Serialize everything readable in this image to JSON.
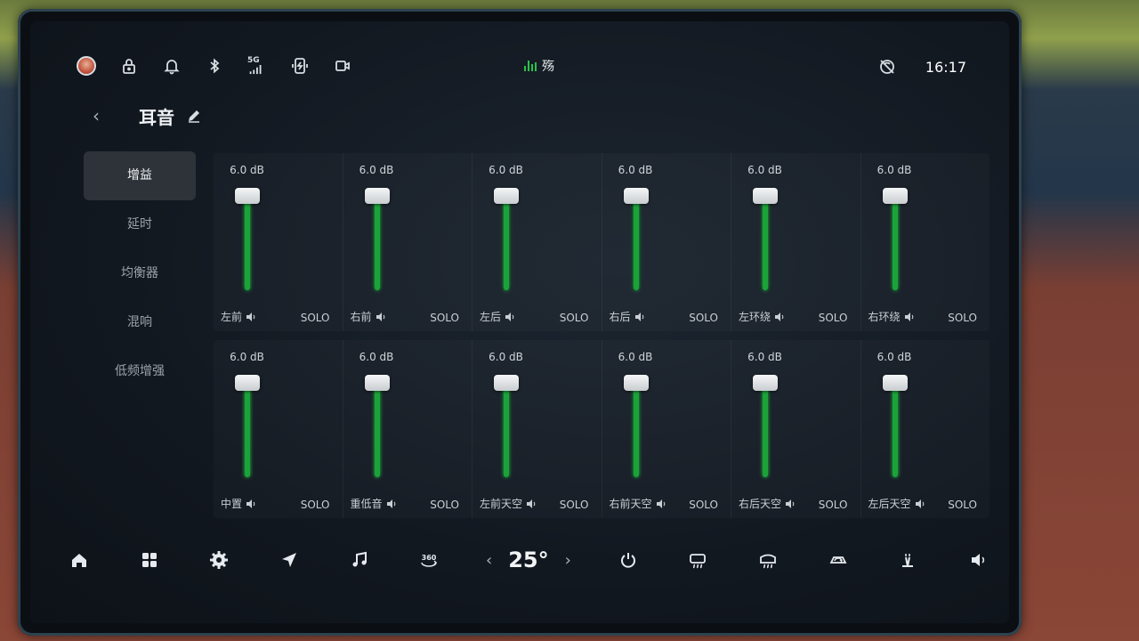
{
  "status_bar": {
    "network_label": "5G",
    "media_text": "殇",
    "time": "16:17",
    "icons": [
      "avatar",
      "lock-icon",
      "bell-icon",
      "bluetooth-icon",
      "signal-5g-icon",
      "phone-charge-icon",
      "camera-icon",
      "voice-off-icon"
    ]
  },
  "header": {
    "title": "耳音"
  },
  "sidebar": {
    "items": [
      {
        "label": "增益",
        "active": true
      },
      {
        "label": "延时",
        "active": false
      },
      {
        "label": "均衡器",
        "active": false
      },
      {
        "label": "混响",
        "active": false
      },
      {
        "label": "低频增强",
        "active": false
      }
    ]
  },
  "channels": {
    "solo_label": "SOLO",
    "row1": [
      {
        "name": "左前",
        "db": "6.0 dB",
        "level": 0.92
      },
      {
        "name": "右前",
        "db": "6.0 dB",
        "level": 0.92
      },
      {
        "name": "左后",
        "db": "6.0 dB",
        "level": 0.92
      },
      {
        "name": "右后",
        "db": "6.0 dB",
        "level": 0.92
      },
      {
        "name": "左环绕",
        "db": "6.0 dB",
        "level": 0.92
      },
      {
        "name": "右环绕",
        "db": "6.0 dB",
        "level": 0.92
      }
    ],
    "row2": [
      {
        "name": "中置",
        "db": "6.0 dB",
        "level": 0.92
      },
      {
        "name": "重低音",
        "db": "6.0 dB",
        "level": 0.92
      },
      {
        "name": "左前天空",
        "db": "6.0 dB",
        "level": 0.92
      },
      {
        "name": "右前天空",
        "db": "6.0 dB",
        "level": 0.92
      },
      {
        "name": "右后天空",
        "db": "6.0 dB",
        "level": 0.92
      },
      {
        "name": "左后天空",
        "db": "6.0 dB",
        "level": 0.92
      }
    ]
  },
  "dock": {
    "temperature": "25",
    "temperature_unit": "°",
    "icons": [
      "home-icon",
      "apps-icon",
      "settings-icon",
      "navigation-icon",
      "music-icon",
      "camera-360-icon",
      "ac-power-icon",
      "rear-defrost-icon",
      "front-defrost-icon",
      "recirculation-icon",
      "seat-heat-icon",
      "volume-icon"
    ],
    "label_360": "360"
  },
  "colors": {
    "accent_green": "#1ba33a",
    "background": "#121820"
  }
}
